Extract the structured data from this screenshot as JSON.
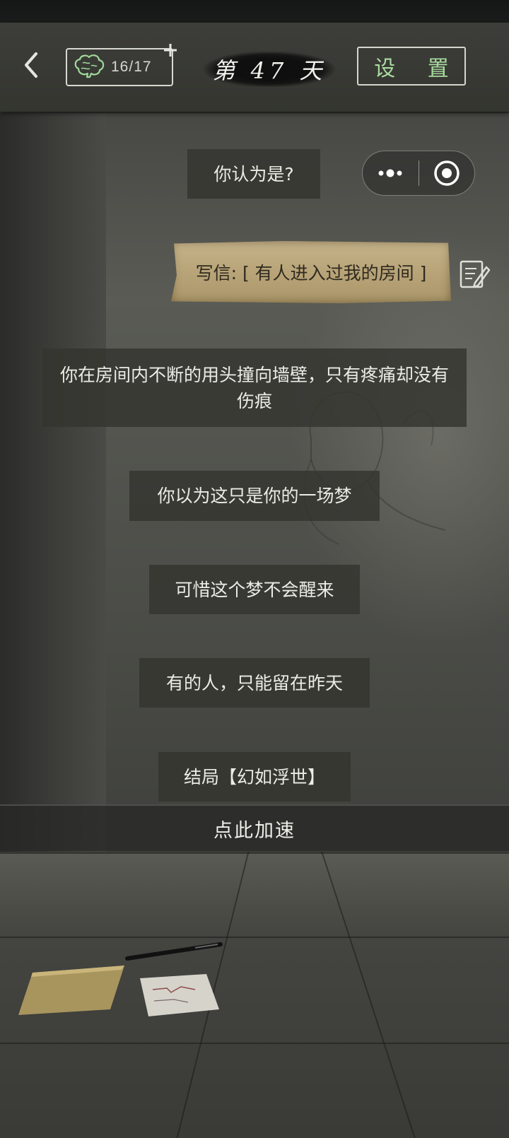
{
  "header": {
    "brain_count": "16/17",
    "day_label": "第 47 天",
    "settings_label": "设 置"
  },
  "messages": {
    "question": "你认为是?",
    "choice": "写信: [ 有人进入过我的房间 ]",
    "narration_1": "你在房间内不断的用头撞向墙壁，只有疼痛却没有伤痕",
    "narration_2": "你以为这只是你的一场梦",
    "narration_3": "可惜这个梦不会醒来",
    "narration_4": "有的人，只能留在昨天",
    "ending": "结局【幻如浮世】"
  },
  "speed_up": {
    "label": "点此加速"
  },
  "icons": {
    "back": "chevron-left-icon",
    "brain": "brain-icon",
    "plus": "plus-icon",
    "more": "more-dots-icon",
    "close_target": "target-circle-icon",
    "edit": "edit-note-icon"
  },
  "colors": {
    "settings_text": "#a9dba0",
    "brain_icon": "#9fd89a",
    "paper": "#bba87c"
  }
}
